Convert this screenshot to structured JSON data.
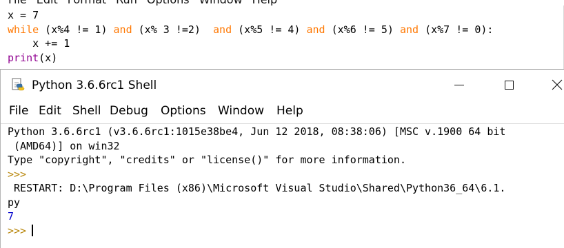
{
  "editor": {
    "menu": [
      "File",
      "Edit",
      "Format",
      "Run",
      "Options",
      "Window",
      "Help"
    ],
    "lines": [
      [
        {
          "t": "x = 7",
          "c": "default"
        }
      ],
      [
        {
          "t": "while",
          "c": "keyword"
        },
        {
          "t": " (x%4 != 1) ",
          "c": "default"
        },
        {
          "t": "and",
          "c": "keyword"
        },
        {
          "t": " (x% 3 !=2)  ",
          "c": "default"
        },
        {
          "t": "and",
          "c": "keyword"
        },
        {
          "t": " (x%5 != 4) ",
          "c": "default"
        },
        {
          "t": "and",
          "c": "keyword"
        },
        {
          "t": " (x%6 != 5) ",
          "c": "default"
        },
        {
          "t": "and",
          "c": "keyword"
        },
        {
          "t": " (x%7 != 0):",
          "c": "default"
        }
      ],
      [
        {
          "t": "    x += 1",
          "c": "default"
        }
      ],
      [
        {
          "t": "print",
          "c": "builtin"
        },
        {
          "t": "(x)",
          "c": "default"
        }
      ]
    ]
  },
  "shell": {
    "title": "Python 3.6.6rc1 Shell",
    "menu": {
      "file": "File",
      "edit": "Edit",
      "shell": "Shell",
      "debug": "Debug",
      "options": "Options",
      "window": "Window",
      "help": "Help"
    },
    "output": [
      {
        "t": "Python 3.6.6rc1 (v3.6.6rc1:1015e38be4, Jun 12 2018, 08:38:06) [MSC v.1900 64 bit",
        "c": "black"
      },
      {
        "t": " (AMD64)] on win32",
        "c": "black"
      },
      {
        "t": "Type \"copyright\", \"credits\" or \"license()\" for more information.",
        "c": "black"
      },
      {
        "t": ">>> ",
        "c": "prompt"
      },
      {
        "t": " RESTART: D:\\Program Files (x86)\\Microsoft Visual Studio\\Shared\\Python36_64\\6.1.",
        "c": "black"
      },
      {
        "t": "py",
        "c": "black"
      },
      {
        "t": "7",
        "c": "blue"
      }
    ],
    "prompt": ">>>"
  },
  "colors": {
    "keyword": "#ff7700",
    "builtin": "#900090",
    "output": "#0000cc",
    "prompt": "#b8860b"
  }
}
